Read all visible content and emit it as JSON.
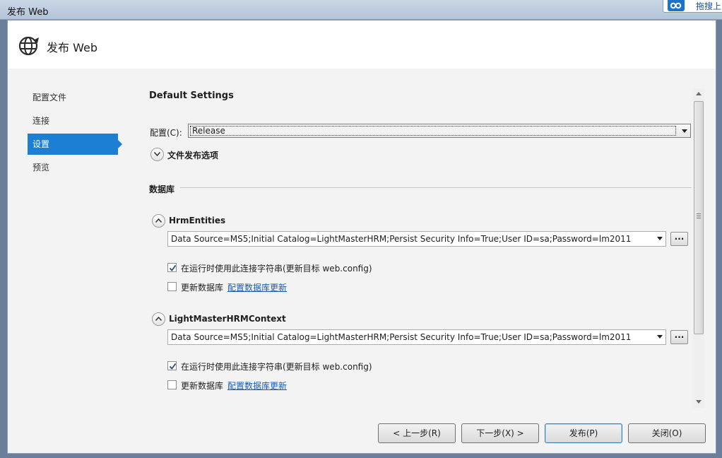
{
  "window": {
    "title": "发布 Web",
    "corner_widget_label": "拖搜上"
  },
  "header": {
    "title": "发布 Web",
    "icon": "globe-publish-icon"
  },
  "nav": {
    "items": [
      {
        "label": "配置文件",
        "active": false
      },
      {
        "label": "连接",
        "active": false
      },
      {
        "label": "设置",
        "active": true
      },
      {
        "label": "预览",
        "active": false
      }
    ]
  },
  "settings": {
    "title": "Default Settings",
    "config_label": "配置(C):",
    "config_value": "Release",
    "file_publish_options": "文件发布选项",
    "database_section": "数据库"
  },
  "databases": [
    {
      "name": "HrmEntities",
      "connection_string": "Data Source=MS5;Initial Catalog=LightMasterHRM;Persist Security Info=True;User ID=sa;Password=lm2011",
      "use_at_runtime_label": "在运行时使用此连接字符串(更新目标 web.config)",
      "use_at_runtime_checked": true,
      "update_db_label": "更新数据库",
      "update_db_checked": false,
      "configure_link": "配置数据库更新"
    },
    {
      "name": "LightMasterHRMContext",
      "connection_string": "Data Source=MS5;Initial Catalog=LightMasterHRM;Persist Security Info=True;User ID=sa;Password=lm2011",
      "use_at_runtime_label": "在运行时使用此连接字符串(更新目标 web.config)",
      "use_at_runtime_checked": true,
      "update_db_label": "更新数据库",
      "update_db_checked": false,
      "configure_link": "配置数据库更新"
    }
  ],
  "footer": {
    "prev": "< 上一步(R)",
    "next": "下一步(X) >",
    "publish": "发布(P)",
    "close": "关闭(O)"
  },
  "colors": {
    "accent": "#1c7fd3",
    "link": "#1a5bb5"
  }
}
